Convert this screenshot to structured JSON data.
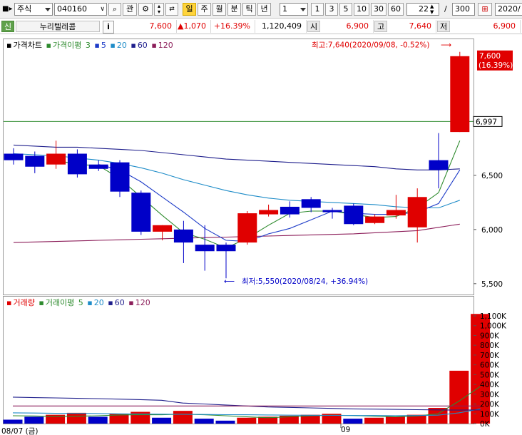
{
  "toolbar": {
    "market_select": "주식",
    "stock_code": "040160",
    "watch_button": "관",
    "periods": [
      {
        "label": "일",
        "active": true
      },
      {
        "label": "주",
        "active": false
      },
      {
        "label": "월",
        "active": false
      },
      {
        "label": "분",
        "active": false
      },
      {
        "label": "틱",
        "active": false
      },
      {
        "label": "년",
        "active": false
      }
    ],
    "interval_value": "1",
    "quick_intervals": [
      "1",
      "3",
      "5",
      "10",
      "30",
      "60"
    ],
    "display_count": "22",
    "separator": "/",
    "max_count": "300",
    "date_field": "2020/"
  },
  "quote": {
    "credit_badge": "신",
    "stock_name": "누리텔레콤",
    "info_button": "i",
    "price": "7,600",
    "change": "▲1,070",
    "change_rate": "+16.39%",
    "volume": "1,120,409",
    "open_label": "시",
    "open_value": "6,900",
    "high_label": "고",
    "high_value": "7,640",
    "low_label": "저",
    "low_value": "6,900"
  },
  "price_panel": {
    "legend_title": "가격차트",
    "ma_title": "가격이평",
    "ma_periods": [
      "3",
      "5",
      "20",
      "60",
      "120"
    ],
    "ma_colors": [
      "#2e8b2e",
      "#1e3cc8",
      "#1e8cc8",
      "#1e1e8c",
      "#8c1e5a"
    ],
    "high_annotation": "최고:7,640(2020/09/08, -0.52%)",
    "high_arrow": "⟶",
    "low_annotation": "최저:5,550(2020/08/24, +36.94%)",
    "low_arrow": "⟵",
    "current_price_label": "7,600",
    "current_rate_label": "(16.39%)",
    "crosshair_value": "6,997",
    "y_ticks": [
      "6,500",
      "6,000",
      "5,500"
    ]
  },
  "volume_panel": {
    "legend_title": "거래량",
    "ma_title": "거래이평",
    "ma_periods": [
      "5",
      "20",
      "60",
      "120"
    ],
    "y_ticks": [
      "1,100K",
      "1,000K",
      "900K",
      "800K",
      "700K",
      "600K",
      "500K",
      "400K",
      "300K",
      "200K",
      "100K",
      "0K"
    ]
  },
  "x_axis": {
    "start_label": "08/07 (금)",
    "month_label": "09"
  },
  "colors": {
    "up": "#e00000",
    "down": "#0000c8",
    "crosshair": "#2e8b2e"
  },
  "chart_data": {
    "type": "candlestick",
    "title": "가격차트",
    "ylim": [
      5400,
      7750
    ],
    "candles": [
      {
        "open": 6700,
        "high": 6750,
        "low": 6600,
        "close": 6640
      },
      {
        "open": 6680,
        "high": 6720,
        "low": 6520,
        "close": 6580
      },
      {
        "open": 6600,
        "high": 6820,
        "low": 6560,
        "close": 6700
      },
      {
        "open": 6700,
        "high": 6740,
        "low": 6480,
        "close": 6510
      },
      {
        "open": 6600,
        "high": 6640,
        "low": 6540,
        "close": 6560
      },
      {
        "open": 6620,
        "high": 6640,
        "low": 6300,
        "close": 6350
      },
      {
        "open": 6340,
        "high": 6360,
        "low": 5950,
        "close": 5980
      },
      {
        "open": 5980,
        "high": 6040,
        "low": 5900,
        "close": 6040
      },
      {
        "open": 6000,
        "high": 6080,
        "low": 5690,
        "close": 5880
      },
      {
        "open": 5860,
        "high": 6040,
        "low": 5620,
        "close": 5800
      },
      {
        "open": 5860,
        "high": 5880,
        "low": 5550,
        "close": 5800
      },
      {
        "open": 5880,
        "high": 6170,
        "low": 5860,
        "close": 6150
      },
      {
        "open": 6140,
        "high": 6230,
        "low": 6120,
        "close": 6180
      },
      {
        "open": 6210,
        "high": 6260,
        "low": 6110,
        "close": 6140
      },
      {
        "open": 6280,
        "high": 6300,
        "low": 6160,
        "close": 6200
      },
      {
        "open": 6180,
        "high": 6200,
        "low": 6100,
        "close": 6160
      },
      {
        "open": 6220,
        "high": 6240,
        "low": 6040,
        "close": 6050
      },
      {
        "open": 6060,
        "high": 6140,
        "low": 6050,
        "close": 6120
      },
      {
        "open": 6130,
        "high": 6320,
        "low": 6100,
        "close": 6180
      },
      {
        "open": 6020,
        "high": 6380,
        "low": 5880,
        "close": 6300
      },
      {
        "open": 6640,
        "high": 6890,
        "low": 6380,
        "close": 6550
      },
      {
        "open": 6900,
        "high": 7640,
        "low": 6900,
        "close": 7600
      }
    ],
    "ma": [
      {
        "period": "3",
        "values": [
          null,
          null,
          6640,
          6600,
          6590,
          6470,
          6300,
          6130,
          5970,
          5910,
          5830,
          5920,
          6040,
          6150,
          6170,
          6170,
          6140,
          6110,
          6120,
          6200,
          6340,
          6820
        ]
      },
      {
        "period": "5",
        "values": [
          null,
          null,
          null,
          null,
          6600,
          6550,
          6440,
          6300,
          6160,
          6010,
          5900,
          5890,
          5960,
          6010,
          6090,
          6170,
          6150,
          6140,
          6140,
          6160,
          6240,
          6550
        ]
      },
      {
        "period": "20",
        "values": [
          6700,
          6690,
          6680,
          6660,
          6640,
          6610,
          6570,
          6520,
          6460,
          6410,
          6360,
          6320,
          6290,
          6270,
          6260,
          6250,
          6240,
          6230,
          6210,
          6200,
          6200,
          6270
        ]
      },
      {
        "period": "60",
        "values": [
          6780,
          6770,
          6760,
          6760,
          6750,
          6740,
          6730,
          6710,
          6690,
          6670,
          6650,
          6640,
          6630,
          6620,
          6610,
          6600,
          6590,
          6580,
          6560,
          6550,
          6550,
          6560
        ]
      },
      {
        "period": "120",
        "values": [
          5880,
          5885,
          5890,
          5895,
          5900,
          5905,
          5910,
          5915,
          5920,
          5925,
          5930,
          5935,
          5940,
          5945,
          5950,
          5955,
          5960,
          5970,
          5980,
          5990,
          6020,
          6050
        ]
      }
    ],
    "volume": {
      "ylim": [
        0,
        1180
      ],
      "unit": "K",
      "values": [
        40,
        70,
        90,
        110,
        70,
        100,
        120,
        60,
        130,
        50,
        30,
        60,
        70,
        80,
        90,
        100,
        50,
        60,
        70,
        90,
        160,
        540,
        1120
      ],
      "is_up": [
        false,
        false,
        true,
        true,
        false,
        true,
        true,
        false,
        true,
        false,
        false,
        true,
        true,
        true,
        true,
        true,
        false,
        true,
        true,
        true,
        true,
        true,
        true
      ],
      "ma": [
        {
          "period": "5",
          "values": [
            80,
            78,
            72,
            75,
            80,
            88,
            92,
            90,
            96,
            90,
            80,
            70,
            60,
            70,
            80,
            85,
            82,
            76,
            70,
            78,
            100,
            230,
            380
          ]
        },
        {
          "period": "20",
          "values": [
            110,
            108,
            105,
            104,
            103,
            100,
            98,
            96,
            95,
            93,
            91,
            90,
            88,
            86,
            85,
            84,
            83,
            82,
            81,
            82,
            86,
            110,
            150
          ]
        },
        {
          "period": "60",
          "values": [
            270,
            265,
            262,
            258,
            255,
            250,
            245,
            238,
            210,
            200,
            190,
            180,
            170,
            165,
            160,
            155,
            150,
            148,
            145,
            142,
            140,
            138,
            140
          ]
        },
        {
          "period": "120",
          "values": [
            180,
            180,
            180,
            180,
            180,
            180,
            180,
            180,
            180,
            180,
            180,
            180,
            180,
            180,
            180,
            180,
            180,
            180,
            180,
            180,
            180,
            180,
            180
          ]
        }
      ]
    }
  }
}
